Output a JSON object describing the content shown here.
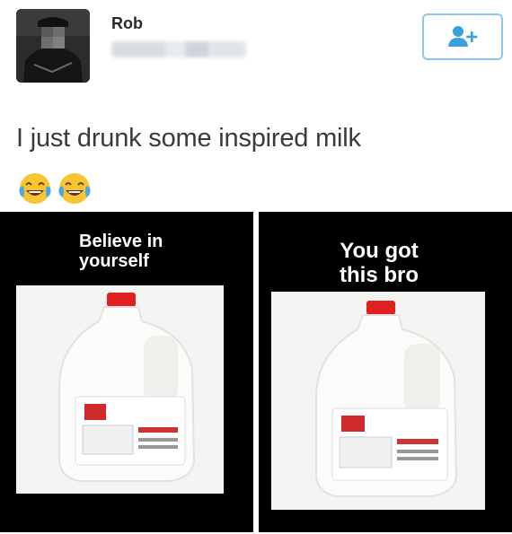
{
  "post": {
    "username": "Rob",
    "text": "I just drunk some inspired milk",
    "emojis": [
      "face-with-tears-of-joy-icon",
      "face-with-tears-of-joy-icon"
    ]
  },
  "memes": [
    {
      "caption": "Believe in yourself"
    },
    {
      "caption": "You got this bro"
    }
  ],
  "colors": {
    "follow_border": "#8ec7ea",
    "follow_icon": "#3aa0e0",
    "panel_bg": "#000000",
    "milk_cap": "#e02020"
  }
}
